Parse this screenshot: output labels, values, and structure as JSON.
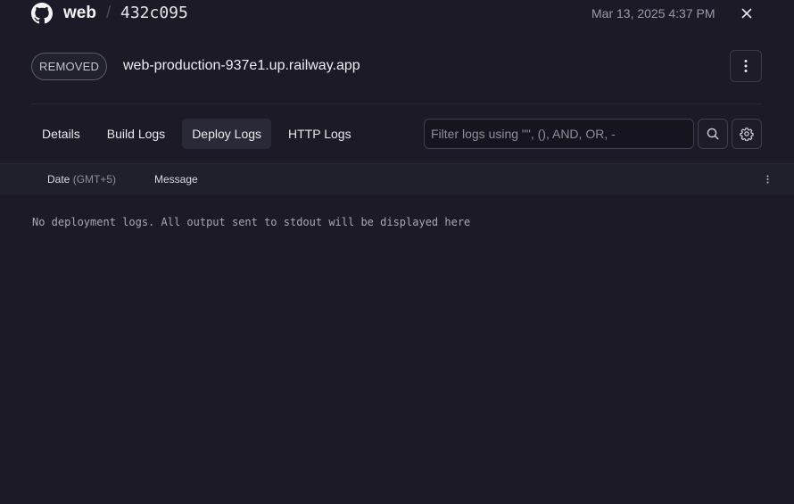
{
  "header": {
    "service_name": "web",
    "separator": "/",
    "commit": "432c095",
    "timestamp": "Mar 13, 2025 4:37 PM"
  },
  "deployment": {
    "status": "REMOVED",
    "url": "web-production-937e1.up.railway.app"
  },
  "tabs": [
    {
      "label": "Details",
      "active": false
    },
    {
      "label": "Build Logs",
      "active": false
    },
    {
      "label": "Deploy Logs",
      "active": true
    },
    {
      "label": "HTTP Logs",
      "active": false
    }
  ],
  "filter": {
    "placeholder": "Filter logs using \"\", (), AND, OR, -",
    "value": ""
  },
  "log_table": {
    "date_col": "Date",
    "timezone": "(GMT+5)",
    "message_col": "Message",
    "empty_message": "No deployment logs. All output sent to stdout will be displayed here"
  },
  "icons": {
    "brand": "github-icon",
    "close": "close-icon",
    "more": "more-vertical-icon",
    "search": "search-icon",
    "settings": "gear-icon",
    "column_menu": "more-vertical-icon"
  }
}
